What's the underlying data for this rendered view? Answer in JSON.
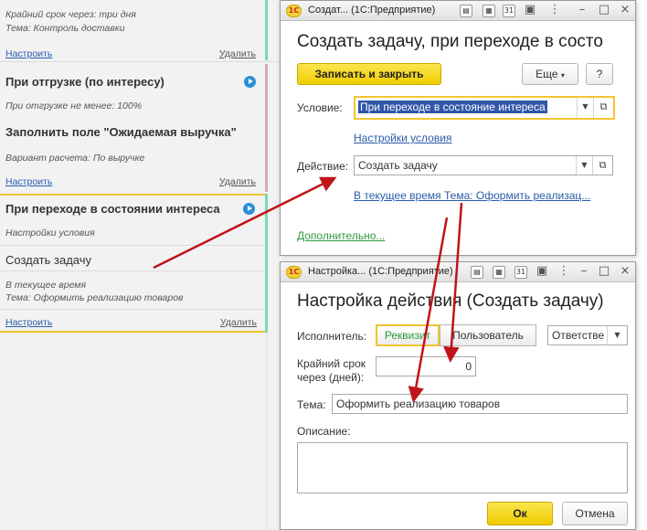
{
  "left_panel": {
    "block1": {
      "line1": "Крайний срок через: три дня",
      "line2": "Тема: Контроль доставки",
      "configure": "Настроить",
      "delete": "Удалить"
    },
    "block2": {
      "condition_title": "При отгрузке (по интересу)",
      "condition_detail": "При отгрузке не менее: 100%",
      "action_title": "Заполнить  поле \"Ожидаемая  выручка\"",
      "action_detail": "Вариант расчета: По выручке",
      "configure": "Настроить",
      "delete": "Удалить"
    },
    "block3": {
      "condition_title": "При переходе в состоянии интереса",
      "condition_detail": "Настройки условия",
      "action_title": "Создать задачу",
      "action_detail_1": "В текущее время",
      "action_detail_2": "Тема: Оформить реализацию товаров",
      "configure": "Настроить",
      "delete": "Удалить"
    }
  },
  "window1": {
    "title": "Создат... (1С:Предприятие)",
    "heading": "Создать задачу, при переходе в состо",
    "save_close": "Записать и закрыть",
    "more": "Еще",
    "help": "?",
    "condition_label": "Условие:",
    "condition_value": "При переходе в состояние интереса",
    "condition_settings_link": "Настройки условия",
    "action_label": "Действие:",
    "action_value": "Создать задачу",
    "action_summary_link": "В текущее время Тема: Оформить реализац...",
    "additional_link": "Дополнительно..."
  },
  "window2": {
    "title": "Настройка... (1С:Предприятие)",
    "heading": "Настройка действия (Создать задачу)",
    "executor_label": "Исполнитель:",
    "executor_options": [
      "Реквизит",
      "Пользователь"
    ],
    "executor_value": "Ответстве",
    "deadline_label_1": "Крайний срок",
    "deadline_label_2": "через (дней):",
    "deadline_value": "0",
    "subject_label": "Тема:",
    "subject_value": "Оформить реализацию товаров",
    "description_label": "Описание:",
    "description_value": "",
    "ok": "Ок",
    "cancel": "Отмена"
  },
  "colors": {
    "primary_button": "#f4d21c",
    "link": "#2a5ca8",
    "selection": "#2f56a8",
    "annotation_arrow": "#c0141a",
    "active_highlight": "#f0c530",
    "rail_green": "#7ad9b7",
    "rail_pink": "#d6a6c1"
  }
}
